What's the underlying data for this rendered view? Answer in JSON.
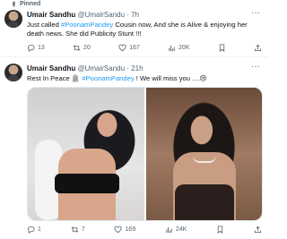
{
  "tweets": [
    {
      "pinned_label": "Pinned",
      "name": "Umair Sandhu",
      "handle": "@UmairSandu",
      "separator": "·",
      "time": "7h",
      "text_before": "Just called ",
      "hashtag": "#PoonamPandey",
      "text_after": " Cousin now, And she is Alive & enjoying her death news. She did Publicity Stunt !!!",
      "more": "···",
      "replies": "13",
      "retweets": "20",
      "likes": "167",
      "views": "20K"
    },
    {
      "name": "Umair Sandhu",
      "handle": "@UmairSandu",
      "separator": "·",
      "time": "21h",
      "text_before": "Rest In Peace 🪦 ",
      "hashtag": "#PoonamPandey",
      "text_after": " ! We will miss you ....😢",
      "more": "···",
      "replies": "1",
      "retweets": "7",
      "likes": "169",
      "views": "24K"
    }
  ]
}
